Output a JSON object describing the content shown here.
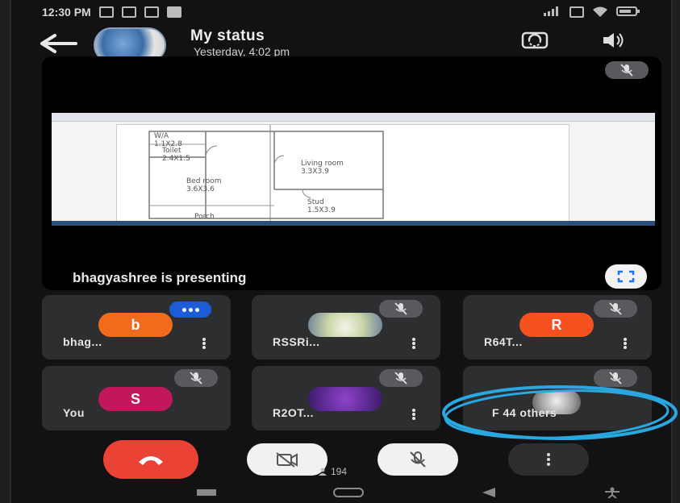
{
  "status_bar": {
    "time": "12:30 PM"
  },
  "header": {
    "title": "My status",
    "subtitle": "Yesterday, 4:02 pm"
  },
  "stage": {
    "presenting_text": "bhagyashree is presenting",
    "floor_plan": {
      "wia": "W/A",
      "wia_size": "1.1X2.8",
      "toilet": "Toilet",
      "toilet_size": "2.4X1.5",
      "bedroom": "Bed room",
      "bedroom_size": "3.6X3.6",
      "living": "Living room",
      "living_size": "3.3X3.9",
      "stud": "Stud",
      "stud_size": "1.5X3.9",
      "porch": "Porch"
    }
  },
  "participants": [
    {
      "initial": "b",
      "name": "bhag...",
      "color": "#f26b1d"
    },
    {
      "initial": "",
      "name": "RSSRi...",
      "color": "#cfcfcf"
    },
    {
      "initial": "R",
      "name": "R64T...",
      "color": "#f4511e"
    },
    {
      "initial": "S",
      "name": "You",
      "color": "#c2185b"
    },
    {
      "initial": "",
      "name": "R2OT...",
      "color": "#6a1b9a"
    },
    {
      "initial": "",
      "name": "F 44 others",
      "color": "#9e9e9e"
    }
  ],
  "controls": {
    "participant_count": "194"
  },
  "colors": {
    "end_call": "#ea4335",
    "annotation": "#29a8e0",
    "raise_hand_chip": "#1e5bd6"
  }
}
